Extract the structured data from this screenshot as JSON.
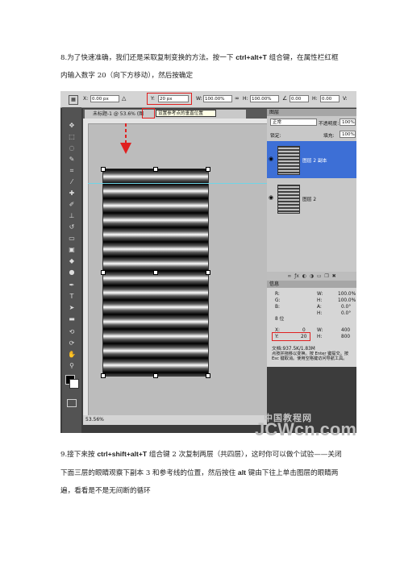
{
  "step8": {
    "line1_a": "8.为了快速准确，我们还是采取复制变换的方法。按一下 ",
    "line1_key": "ctrl+alt+T",
    "line1_b": " 组合键，在属性栏红框",
    "line2": "内输入数字 20（向下方移动），然后按确定"
  },
  "options_bar": {
    "x_label": "X:",
    "x_value": "0.00 px",
    "y_label": "Y:",
    "y_value": "20 px",
    "w_label": "W:",
    "w_value": "100.00%",
    "h_label": "H:",
    "h_value": "100.00%",
    "rot_value": "0.00",
    "hskew_label": "H:",
    "hskew_value": "0.00",
    "vskew_label": "V:"
  },
  "document": {
    "tab_title": "未标题-1 @ 53.6% (图",
    "tooltip": "设置参考点的垂直位置",
    "zoom_status": "53.56%"
  },
  "layers_panel": {
    "title": "图层",
    "blend_mode": "正常",
    "opacity_label": "不透明度:",
    "opacity_value": "100%",
    "lock_label": "锁定:",
    "fill_label": "填充:",
    "fill_value": "100%",
    "layers": [
      {
        "name": "图层 2 副本",
        "selected": true
      },
      {
        "name": "图层 2",
        "selected": false
      }
    ]
  },
  "info_panel": {
    "title": "信息",
    "r_label": "R:",
    "g_label": "G:",
    "b_label": "B:",
    "bit_label": "8 位",
    "w_pct_label": "W:",
    "w_pct": "100.0%",
    "h_pct_label": "H:",
    "h_pct": "100.0%",
    "a_label": "A:",
    "a_value": "0.0°",
    "h_deg_label": "H:",
    "h_deg": "0.0°",
    "x_label": "X:",
    "x_value": "0",
    "y_label": "Y:",
    "y_value": "20",
    "w_label": "W:",
    "w_value": "400",
    "h_label": "H:",
    "h_value": "800",
    "doc_size": "文档:937.5K/1.83M",
    "hint": "点按并拖移以变换。按 Enter 键提交。按 Esc 键取消。使用空格键访问导航工具。"
  },
  "watermark": {
    "line1": "中国教程网",
    "line2": "JCWcn.com"
  },
  "step9": {
    "line1_a": "9.接下来按 ",
    "line1_key": "ctrl+shift+alt+T",
    "line1_b": " 组合键 2 次复制两层（共四层），这时你可以做个试验——关闭",
    "line2_a": "下面三层的眼睛观察下副本 3 和参考线的位置，然后按住 ",
    "line2_key": "alt",
    "line2_b": " 键由下往上单击图层的眼睛两",
    "line3": "遍，看看是不是无间断的循环"
  },
  "colors": {
    "highlight_red": "#e02020",
    "selection_blue": "#3d6fd6"
  }
}
